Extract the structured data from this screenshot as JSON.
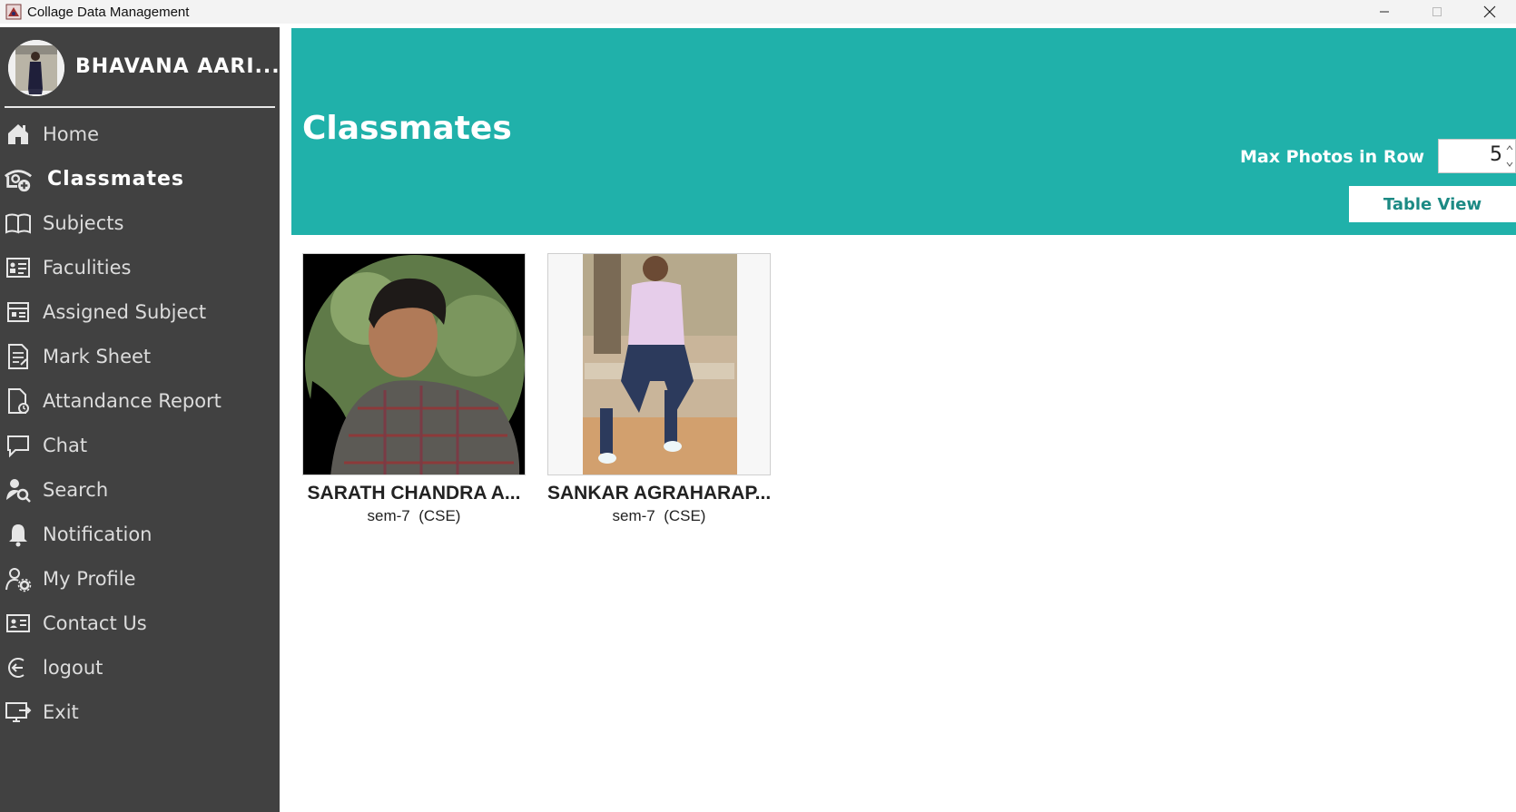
{
  "window": {
    "title": "Collage Data Management",
    "controls": [
      "minimize-icon",
      "maximize-icon",
      "close-icon"
    ]
  },
  "sidebar": {
    "user_name": "BHAVANA AARI...",
    "items": [
      {
        "label": "Home",
        "icon": "home-icon"
      },
      {
        "label": "Classmates",
        "icon": "classmates-icon",
        "active": true
      },
      {
        "label": "Subjects",
        "icon": "book-icon"
      },
      {
        "label": "Faculities",
        "icon": "faculty-icon"
      },
      {
        "label": "Assigned Subject",
        "icon": "assigned-subject-icon"
      },
      {
        "label": "Mark Sheet",
        "icon": "mark-sheet-icon"
      },
      {
        "label": "Attandance Report",
        "icon": "attendance-report-icon"
      },
      {
        "label": "Chat",
        "icon": "chat-icon"
      },
      {
        "label": "Search",
        "icon": "search-user-icon"
      },
      {
        "label": "Notification",
        "icon": "bell-icon"
      },
      {
        "label": "My Profile",
        "icon": "profile-settings-icon"
      },
      {
        "label": "Contact Us",
        "icon": "contact-card-icon"
      },
      {
        "label": "logout",
        "icon": "logout-icon"
      },
      {
        "label": "Exit",
        "icon": "exit-icon"
      }
    ]
  },
  "header": {
    "title": "Classmates",
    "max_photos_label": "Max Photos in Row",
    "max_photos_value": "5",
    "table_view_label": "Table View"
  },
  "classmates": [
    {
      "name": "SARATH CHANDRA A...",
      "sem": "sem-7",
      "branch": "(CSE)",
      "subtitle": "sem-7  (CSE)"
    },
    {
      "name": "SANKAR AGRAHARAP...",
      "sem": "sem-7",
      "branch": "(CSE)",
      "subtitle": "sem-7  (CSE)"
    }
  ],
  "colors": {
    "sidebar_bg": "#414141",
    "header_bg": "#20b1aa",
    "accent_text": "#1c8a84"
  }
}
